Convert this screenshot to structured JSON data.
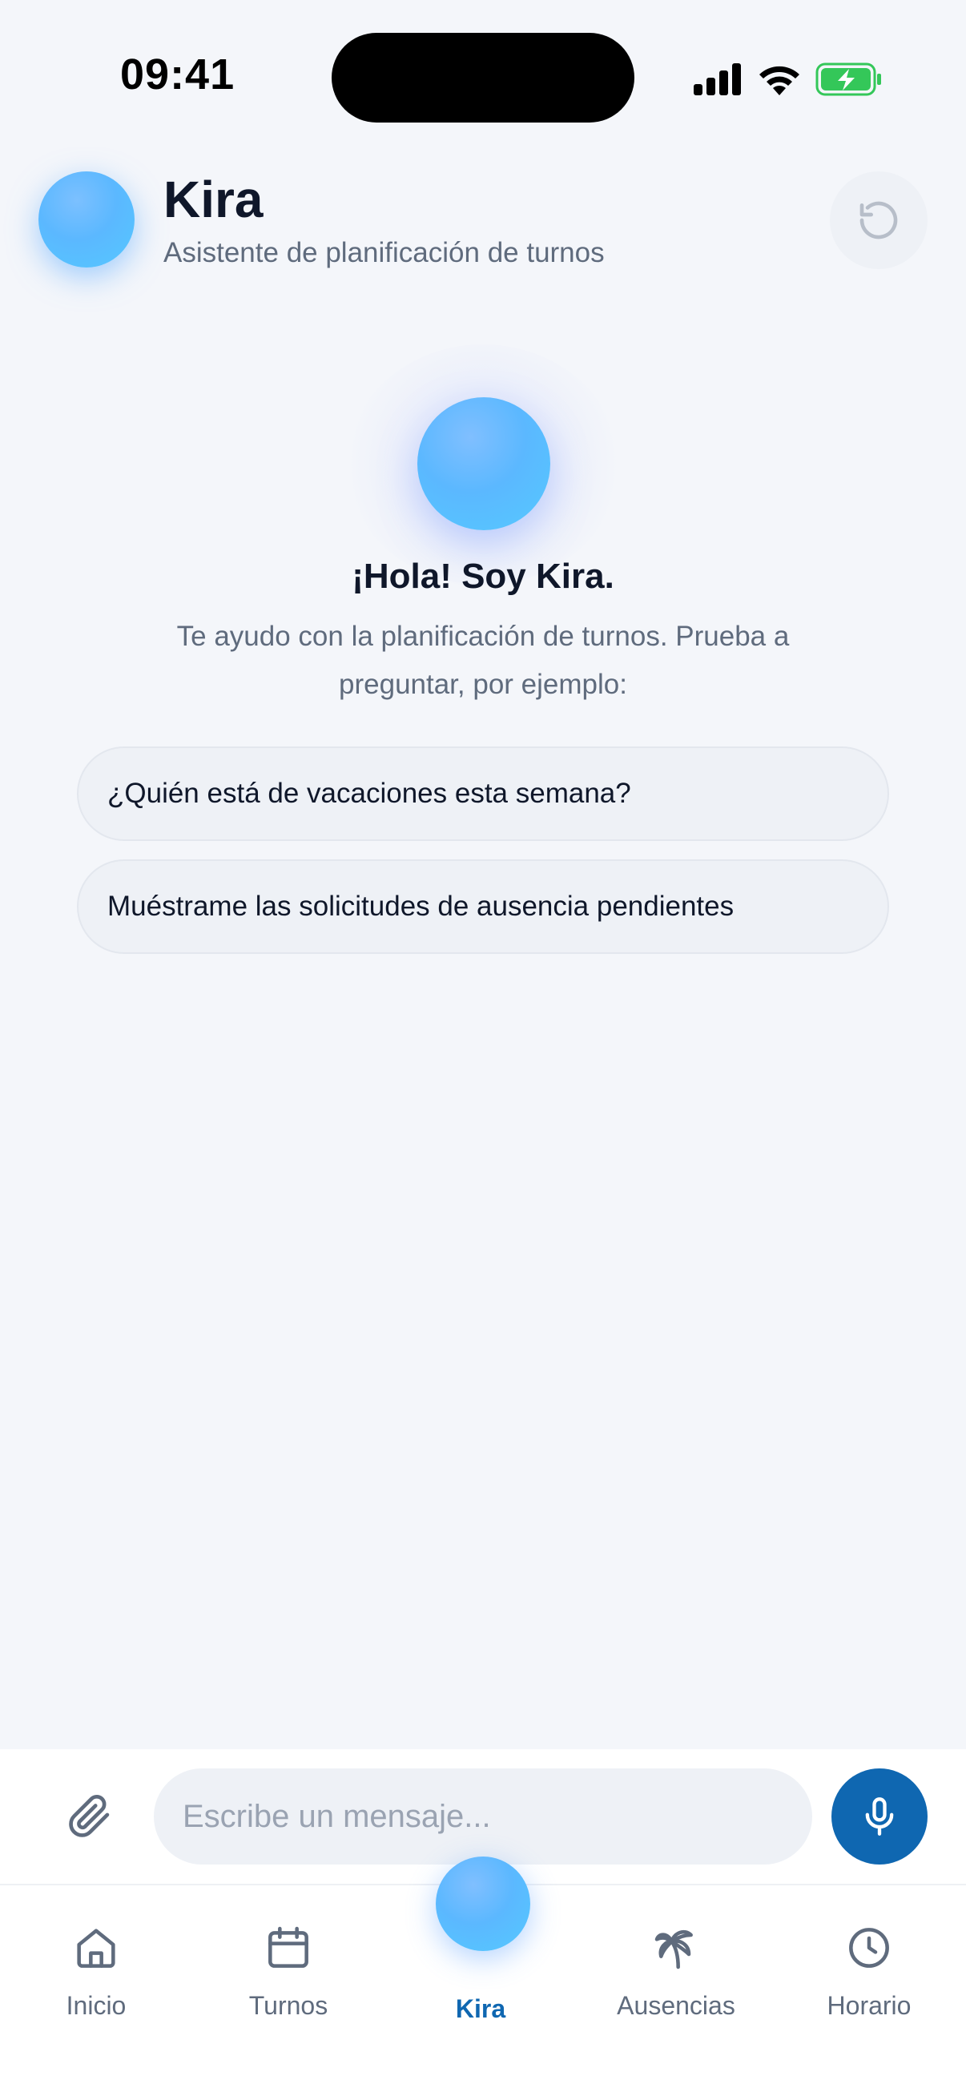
{
  "status_bar": {
    "time": "09:41"
  },
  "header": {
    "title": "Kira",
    "subtitle": "Asistente de planificación de turnos",
    "reset_icon": "refresh-icon"
  },
  "welcome": {
    "title": "¡Hola! Soy Kira.",
    "text": "Te ayudo con la planificación de turnos. Prueba a preguntar, por ejemplo:"
  },
  "suggestions": [
    "¿Quién está de vacaciones esta semana?",
    "Muéstrame las solicitudes de ausencia pendientes"
  ],
  "composer": {
    "placeholder": "Escribe un mensaje...",
    "attach_icon": "paperclip-icon",
    "mic_icon": "microphone-icon"
  },
  "tabs": [
    {
      "label": "Inicio",
      "icon": "home-icon"
    },
    {
      "label": "Turnos",
      "icon": "calendar-icon"
    },
    {
      "label": "Kira",
      "icon": "kira-orb-icon",
      "active": true
    },
    {
      "label": "Ausencias",
      "icon": "palm-tree-icon"
    },
    {
      "label": "Horario",
      "icon": "clock-icon"
    }
  ],
  "colors": {
    "accent": "#0f67b1",
    "background": "#f4f6fa",
    "orb": "#5bb8ff",
    "battery": "#34c759"
  }
}
